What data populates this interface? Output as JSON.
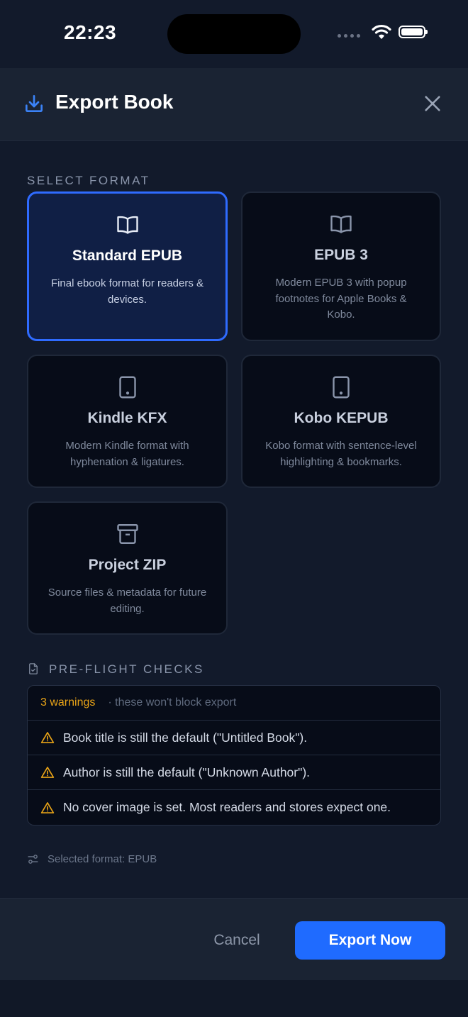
{
  "status_bar": {
    "time": "22:23"
  },
  "header": {
    "title": "Export Book",
    "icon": "download-icon",
    "close_icon": "close-icon"
  },
  "format_section": {
    "label": "SELECT FORMAT",
    "selected_index": 0,
    "options": [
      {
        "title": "Standard EPUB",
        "description": "Final ebook format for readers & devices.",
        "icon": "book-open-icon"
      },
      {
        "title": "EPUB 3",
        "description": "Modern EPUB 3 with popup footnotes for Apple Books & Kobo.",
        "icon": "book-open-icon"
      },
      {
        "title": "Kindle KFX",
        "description": "Modern Kindle format with hyphenation & ligatures.",
        "icon": "tablet-icon"
      },
      {
        "title": "Kobo KEPUB",
        "description": "Kobo format with sentence-level highlighting & bookmarks.",
        "icon": "tablet-icon"
      },
      {
        "title": "Project ZIP",
        "description": "Source files & metadata for future editing.",
        "icon": "archive-icon"
      }
    ]
  },
  "checks_section": {
    "label": "PRE-FLIGHT CHECKS",
    "icon": "file-check-icon",
    "summary": {
      "count_label": "3 warnings",
      "note": "· these won't block export"
    },
    "warnings": [
      "Book title is still the default (\"Untitled Book\").",
      "Author is still the default (\"Unknown Author\").",
      "No cover image is set. Most readers and stores expect one."
    ]
  },
  "selected_format": {
    "text": "Selected format: EPUB",
    "icon": "sliders-icon"
  },
  "footer": {
    "cancel_label": "Cancel",
    "export_label": "Export Now"
  },
  "colors": {
    "accent": "#2f6bff",
    "button": "#1f6bff",
    "warning": "#e8a317",
    "background": "#121a2b",
    "card": "#070c18"
  }
}
